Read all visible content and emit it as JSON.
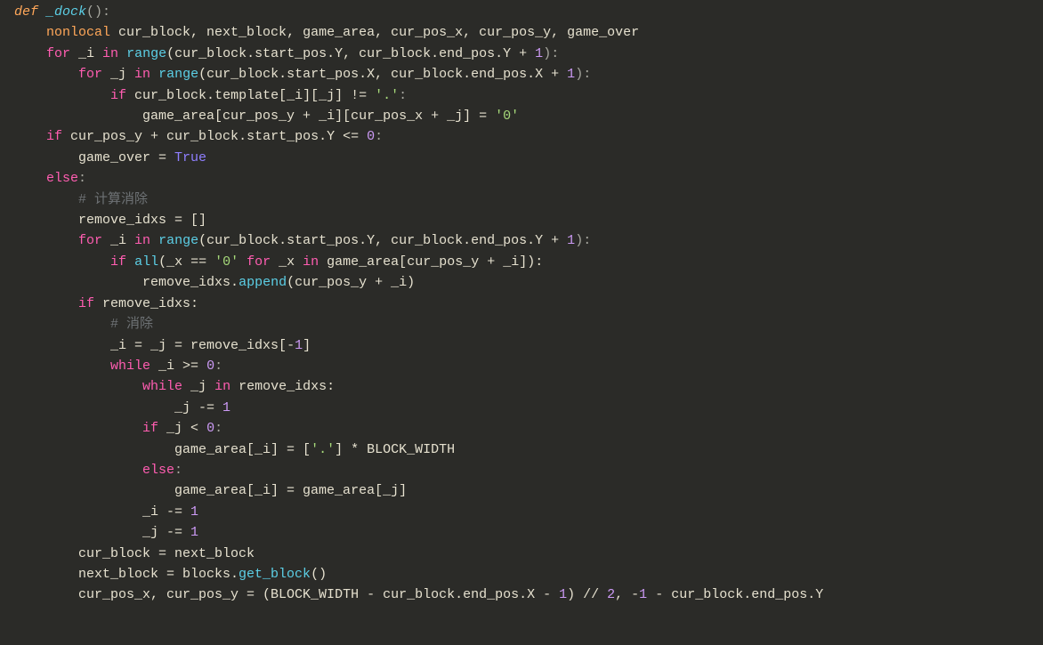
{
  "code": {
    "l1": {
      "def": "def",
      "name": "_dock",
      "p1": "():"
    },
    "l2": {
      "kw": "nonlocal",
      "rest": " cur_block, next_block, game_area, cur_pos_x, cur_pos_y, game_over"
    },
    "l3": {
      "for": "for",
      "var": " _i ",
      "in": "in",
      "sp": " ",
      "range": "range",
      "p1": "(cur_block.start_pos.Y, cur_block.end_pos.Y + ",
      "one": "1",
      "p2": "):"
    },
    "l4": {
      "for": "for",
      "var": " _j ",
      "in": "in",
      "sp": " ",
      "range": "range",
      "p1": "(cur_block.start_pos.X, cur_block.end_pos.X + ",
      "one": "1",
      "p2": "):"
    },
    "l5": {
      "if": "if",
      "mid": " cur_block.template[_i][_j] != ",
      "str": "'.'",
      "colon": ":"
    },
    "l6": {
      "a": "game_area[cur_pos_y + _i][cur_pos_x + _j] = ",
      "str": "'0'"
    },
    "l7": {
      "if": "if",
      "mid": " cur_pos_y + cur_block.start_pos.Y <= ",
      "zero": "0",
      "colon": ":"
    },
    "l8": {
      "a": "game_over = ",
      "true": "True"
    },
    "l9": {
      "else": "else",
      "colon": ":"
    },
    "l10": {
      "cmt": "# 计算消除"
    },
    "l11": {
      "a": "remove_idxs = []"
    },
    "l12": {
      "for": "for",
      "var": " _i ",
      "in": "in",
      "sp": " ",
      "range": "range",
      "p1": "(cur_block.start_pos.Y, cur_block.end_pos.Y + ",
      "one": "1",
      "p2": "):"
    },
    "l13": {
      "if": "if",
      "sp": " ",
      "all": "all",
      "p1": "(_x == ",
      "str": "'0'",
      "sp2": " ",
      "for": "for",
      "mid": " _x ",
      "in": "in",
      "rest": " game_area[cur_pos_y + _i]):"
    },
    "l14": {
      "a": "remove_idxs.",
      "append": "append",
      "b": "(cur_pos_y + _i)"
    },
    "l15": {
      "if": "if",
      "rest": " remove_idxs:"
    },
    "l16": {
      "cmt": "# 消除"
    },
    "l17": {
      "a": "_i = _j = remove_idxs[-",
      "one": "1",
      "b": "]"
    },
    "l18": {
      "while": "while",
      "mid": " _i >= ",
      "zero": "0",
      "colon": ":"
    },
    "l19": {
      "while": "while",
      "mid": " _j ",
      "in": "in",
      "rest": " remove_idxs:"
    },
    "l20": {
      "a": "_j -= ",
      "one": "1"
    },
    "l21": {
      "if": "if",
      "mid": " _j < ",
      "zero": "0",
      "colon": ":"
    },
    "l22": {
      "a": "game_area[_i] = [",
      "str": "'.'",
      "b": "] * BLOCK_WIDTH"
    },
    "l23": {
      "else": "else",
      "colon": ":"
    },
    "l24": {
      "a": "game_area[_i] = game_area[_j]"
    },
    "l25": {
      "a": "_i -= ",
      "one": "1"
    },
    "l26": {
      "a": "_j -= ",
      "one": "1"
    },
    "l27": {
      "a": "cur_block = next_block"
    },
    "l28": {
      "a": "next_block = blocks.",
      "get": "get_block",
      "b": "()"
    },
    "l29": {
      "a": "cur_pos_x, cur_pos_y = (BLOCK_WIDTH - cur_block.end_pos.X - ",
      "one1": "1",
      "b": ") // ",
      "two": "2",
      "c": ", -",
      "one2": "1",
      "d": " - cur_block.end_pos.Y"
    }
  }
}
